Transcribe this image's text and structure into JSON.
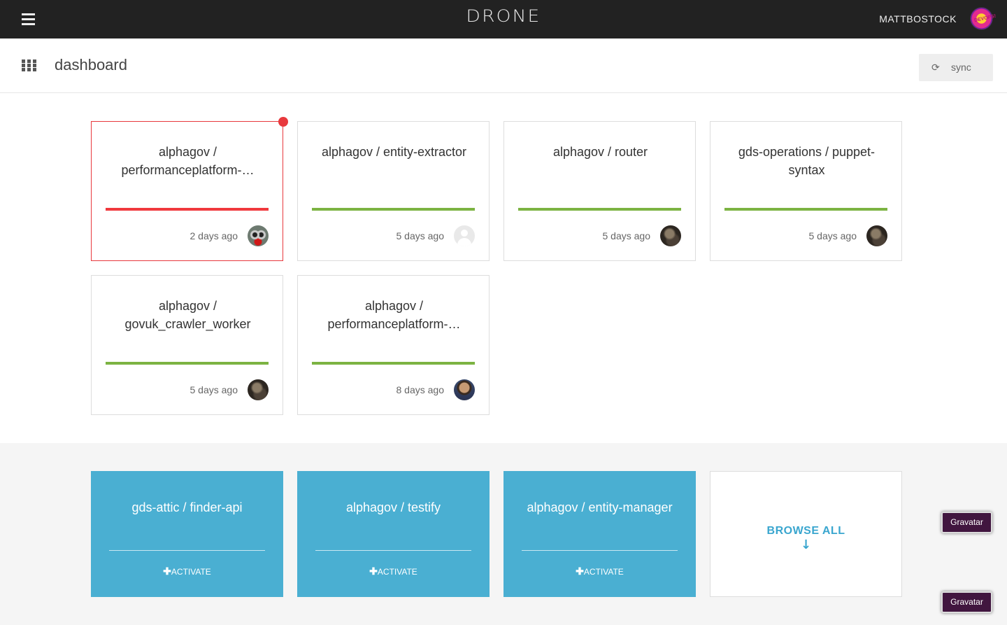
{
  "header": {
    "brand": "DRONE",
    "username": "MATTBOSTOCK",
    "menu_icon": "hamburger-menu-icon",
    "avatar_icon": "user-avatar"
  },
  "subheader": {
    "title": "dashboard",
    "apps_icon": "grid-icon",
    "sync_label": "sync",
    "sync_icon": "refresh-icon"
  },
  "repos": [
    {
      "name": "alphagov / performanceplatform-…",
      "ago": "2 days ago",
      "status": "failed",
      "avatar": "monster-avatar"
    },
    {
      "name": "alphagov / entity-extractor",
      "ago": "5 days ago",
      "status": "success",
      "avatar": "default-avatar"
    },
    {
      "name": "alphagov / router",
      "ago": "5 days ago",
      "status": "success",
      "avatar": "dark-avatar"
    },
    {
      "name": "gds-operations / puppet-syntax",
      "ago": "5 days ago",
      "status": "success",
      "avatar": "dark-avatar"
    },
    {
      "name": "alphagov / govuk_crawler_worker",
      "ago": "5 days ago",
      "status": "success",
      "avatar": "dark-avatar"
    },
    {
      "name": "alphagov / performanceplatform-…",
      "ago": "8 days ago",
      "status": "success",
      "avatar": "person-avatar"
    }
  ],
  "suggestions": [
    {
      "name": "gds-attic / finder-api",
      "action": "ACTIVATE"
    },
    {
      "name": "alphagov / testify",
      "action": "ACTIVATE"
    },
    {
      "name": "alphagov / entity-manager",
      "action": "ACTIVATE"
    }
  ],
  "browse": {
    "label": "BROWSE ALL",
    "arrow": "↓"
  },
  "gravatar_buttons": [
    "Gravatar",
    "Gravatar"
  ],
  "colors": {
    "topbar": "#222222",
    "success": "#7cb342",
    "failed": "#e8393d",
    "accent_blue": "#4aafd2",
    "gravatar": "#41163f"
  }
}
